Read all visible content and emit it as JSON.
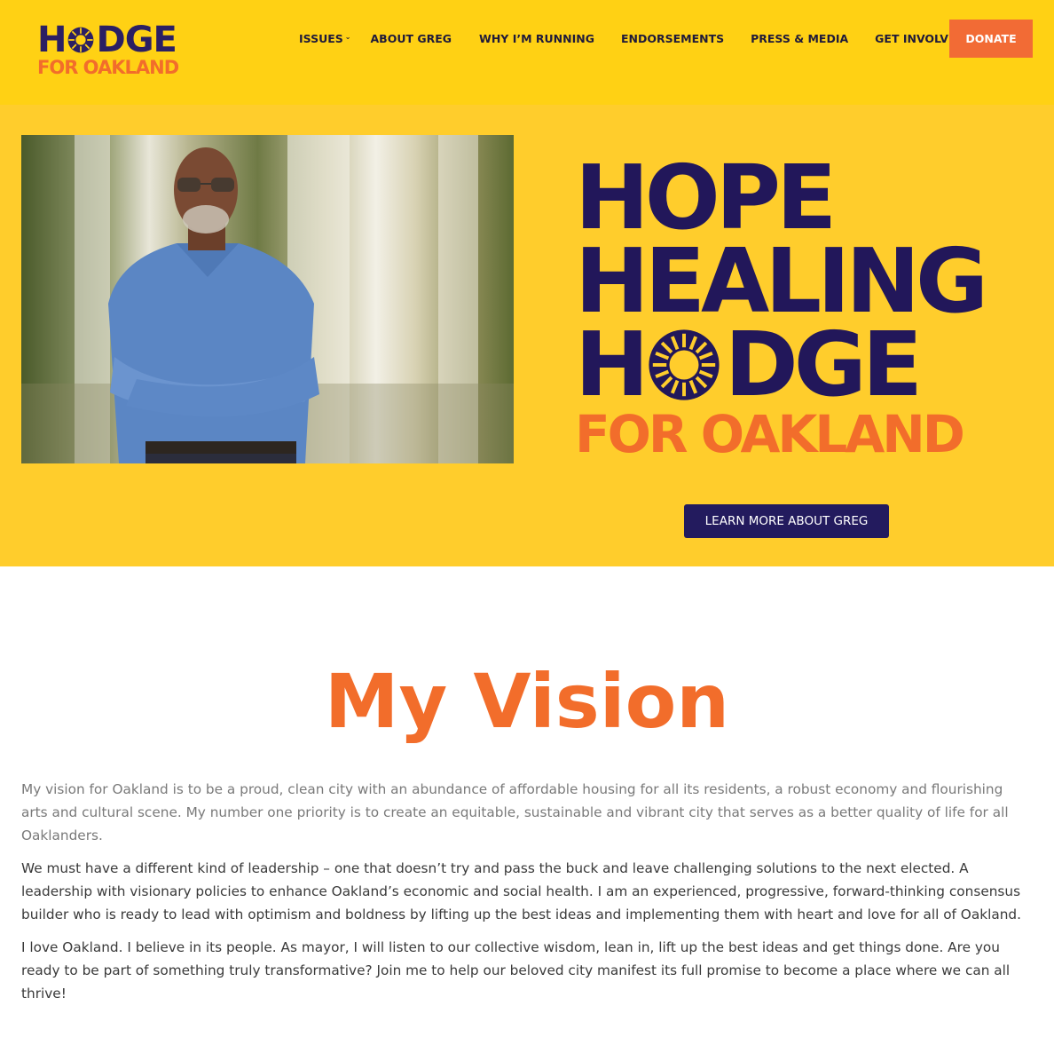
{
  "header": {
    "logo": {
      "top": "HODGE",
      "bottom": "FOR OAKLAND"
    },
    "nav": [
      {
        "label": "ISSUES",
        "has_dropdown": true
      },
      {
        "label": "ABOUT GREG",
        "has_dropdown": false
      },
      {
        "label": "WHY I’M RUNNING",
        "has_dropdown": false
      },
      {
        "label": "ENDORSEMENTS",
        "has_dropdown": false
      },
      {
        "label": "PRESS & MEDIA",
        "has_dropdown": false
      },
      {
        "label": "GET INVOLVED",
        "has_dropdown": false
      }
    ],
    "donate_label": "DONATE"
  },
  "hero": {
    "slogan": {
      "line1": "HOPE",
      "line2": "HEALING",
      "line3": "HODGE",
      "line4": "FOR OAKLAND"
    },
    "cta_label": "LEARN MORE ABOUT GREG"
  },
  "vision": {
    "title": "My Vision",
    "paragraphs": [
      "My vision for Oakland is to be a proud, clean city with an abundance of affordable housing for all its residents, a robust economy and flourishing arts and cultural scene. My number one priority is to create an equitable, sustainable and vibrant city that serves as a better quality of life for all Oaklanders.",
      "We must have a different kind of leadership – one that doesn’t try and pass the buck and leave challenging solutions to the next elected. A leadership with visionary policies to enhance Oakland’s economic and social health. I am an experienced, progressive, forward-thinking consensus builder who is ready to lead with optimism and boldness by lifting up the best ideas and implementing them with heart and love for all of Oakland.",
      "I love Oakland. I believe in its people. As mayor, I will listen to our collective wisdom, lean in, lift up the best ideas and get things done. Are you ready to be part of something truly transformative? Join me to help our beloved city manifest its full promise to become a place where we can all thrive!"
    ]
  },
  "colors": {
    "header_bg": "#ffd114",
    "hero_bg": "#ffcd2c",
    "navy": "#22175a",
    "orange": "#f26d2b",
    "donate_bg": "#f26b35"
  },
  "icons": [
    "sun-icon",
    "chevron-down-icon"
  ]
}
